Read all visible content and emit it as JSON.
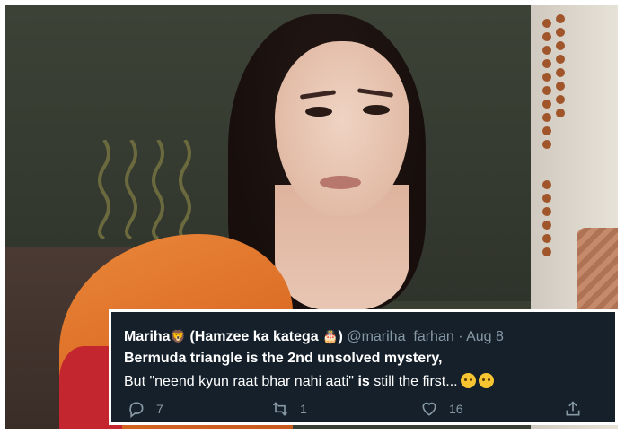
{
  "tweet": {
    "display_name": "Mariha",
    "name_suffix": "(Hamzee ka katega",
    "name_close": ")",
    "handle": "@mariha_farhan",
    "separator": "·",
    "date": "Aug 8",
    "line1": "Bermuda triangle is the 2nd unsolved mystery,",
    "line2_a": "But \"neend kyun raat bhar nahi aati\"",
    "line2_b": "is",
    "line2_c": "still the first...",
    "reply_count": "7",
    "retweet_count": "1",
    "like_count": "16"
  },
  "icons": {
    "reply": "reply-icon",
    "retweet": "retweet-icon",
    "like": "heart-icon",
    "share": "share-icon"
  },
  "colors": {
    "card_bg": "#15202b",
    "secondary_text": "#8899a6",
    "shirt": "#e07a2f"
  }
}
